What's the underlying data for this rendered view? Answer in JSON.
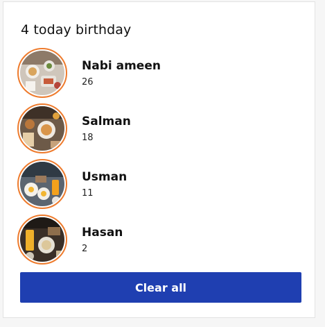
{
  "card": {
    "title": "4 today birthday"
  },
  "birthdays": [
    {
      "name": "Nabi ameen",
      "age": "26",
      "avatar_icon": "food-photo-avatar"
    },
    {
      "name": "Salman",
      "age": "18",
      "avatar_icon": "food-photo-avatar"
    },
    {
      "name": "Usman",
      "age": "11",
      "avatar_icon": "food-photo-avatar"
    },
    {
      "name": "Hasan",
      "age": "2",
      "avatar_icon": "food-photo-avatar"
    }
  ],
  "actions": {
    "clear_all_label": "Clear all"
  },
  "colors": {
    "accent_ring": "#ee7b2d",
    "button_bg": "#1f3fb1",
    "button_text": "#ffffff"
  }
}
